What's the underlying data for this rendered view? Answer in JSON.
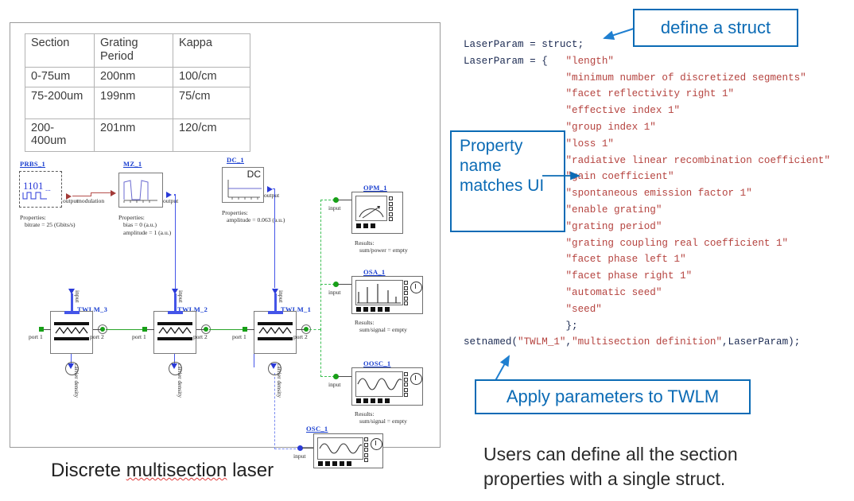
{
  "left": {
    "table": {
      "headers": [
        "Section",
        "Grating Period",
        "Kappa"
      ],
      "rows": [
        [
          "0-75um",
          "200nm",
          "100/cm"
        ],
        [
          "75-200um",
          "199nm",
          "75/cm"
        ],
        [
          "200-400um",
          "201nm",
          "120/cm"
        ]
      ]
    },
    "caption_prefix": "Discrete ",
    "caption_misspelled": "multisection",
    "caption_suffix": " laser",
    "blocks": {
      "prbs": {
        "label": "PRBS_1",
        "waveform_text": "1101...",
        "port_out": "output",
        "props_title": "Properties:",
        "props_line1": "bitrate = 25 (Gbits/s)"
      },
      "mz": {
        "label": "MZ_1",
        "wire_label": "modulation",
        "port_out": "output",
        "props_title": "Properties:",
        "props_line1": "bias = 0 (a.u.)",
        "props_line2": "amplitude = 1 (a.u.)"
      },
      "dc": {
        "label": "DC_1",
        "screen_text": "DC",
        "port_out": "output",
        "props_title": "Properties:",
        "props_line1": "amplitude = 0.063 (a.u.)"
      },
      "twlm3": {
        "label": "TWLM_3",
        "port_in": "port 1",
        "port_out": "port 2",
        "top_port": "input",
        "bottom_port": "carrier density"
      },
      "twlm2": {
        "label": "TWLM_2",
        "port_in": "port 1",
        "port_out": "port 2",
        "top_port": "input",
        "bottom_port": "carrier density"
      },
      "twlm1": {
        "label": "TWLM_1",
        "port_in": "port 1",
        "port_out": "port 2",
        "top_port": "input",
        "bottom_port": "carrier density"
      },
      "opm": {
        "label": "OPM_1",
        "port_in": "input",
        "results_title": "Results:",
        "results_line": "sum/power = empty"
      },
      "osa": {
        "label": "OSA_1",
        "port_in": "input",
        "results_title": "Results:",
        "results_line": "sum/signal = empty"
      },
      "oosc": {
        "label": "OOSC_1",
        "port_in": "input",
        "results_title": "Results:",
        "results_line": "sum/signal = empty"
      },
      "osc": {
        "label": "OSC_1",
        "port_in": "input"
      }
    }
  },
  "right": {
    "code": {
      "line1": "LaserParam = struct;",
      "line2_prefix": "LaserParam = {   ",
      "properties": [
        "\"length\"",
        "\"minimum number of discretized segments\"",
        "\"facet reflectivity right 1\"",
        "\"effective index 1\"",
        "\"group index 1\"",
        "\"loss 1\"",
        "\"radiative linear recombination coefficient\"",
        "\"gain coefficient\"",
        "\"spontaneous emission factor 1\"",
        "\"enable grating\"",
        "\"grating period\"",
        "\"grating coupling real coefficient 1\"",
        "\"facet phase left 1\"",
        "\"facet phase right 1\"",
        "\"automatic seed\"",
        "\"seed\""
      ],
      "closing": "};",
      "setnamed_prefix": "setnamed(",
      "setnamed_arg1": "\"TWLM_1\"",
      "setnamed_comma1": ",",
      "setnamed_arg2": "\"multisection definition\"",
      "setnamed_tail": ",LaserParam);"
    },
    "callouts": {
      "define_struct": "define a struct",
      "property_match": "Property name matches UI",
      "apply_params": "Apply parameters to TWLM"
    },
    "caption_line1": "Users can define all the section",
    "caption_line2": "properties with a single struct."
  },
  "colors": {
    "callout_blue": "#0b6bb5",
    "code_string_red": "#b5433f",
    "code_text": "#1b2a52",
    "block_label_blue": "#1a3fd0",
    "optical_green": "#17a017",
    "electrical_blue": "#2a3ad8"
  }
}
